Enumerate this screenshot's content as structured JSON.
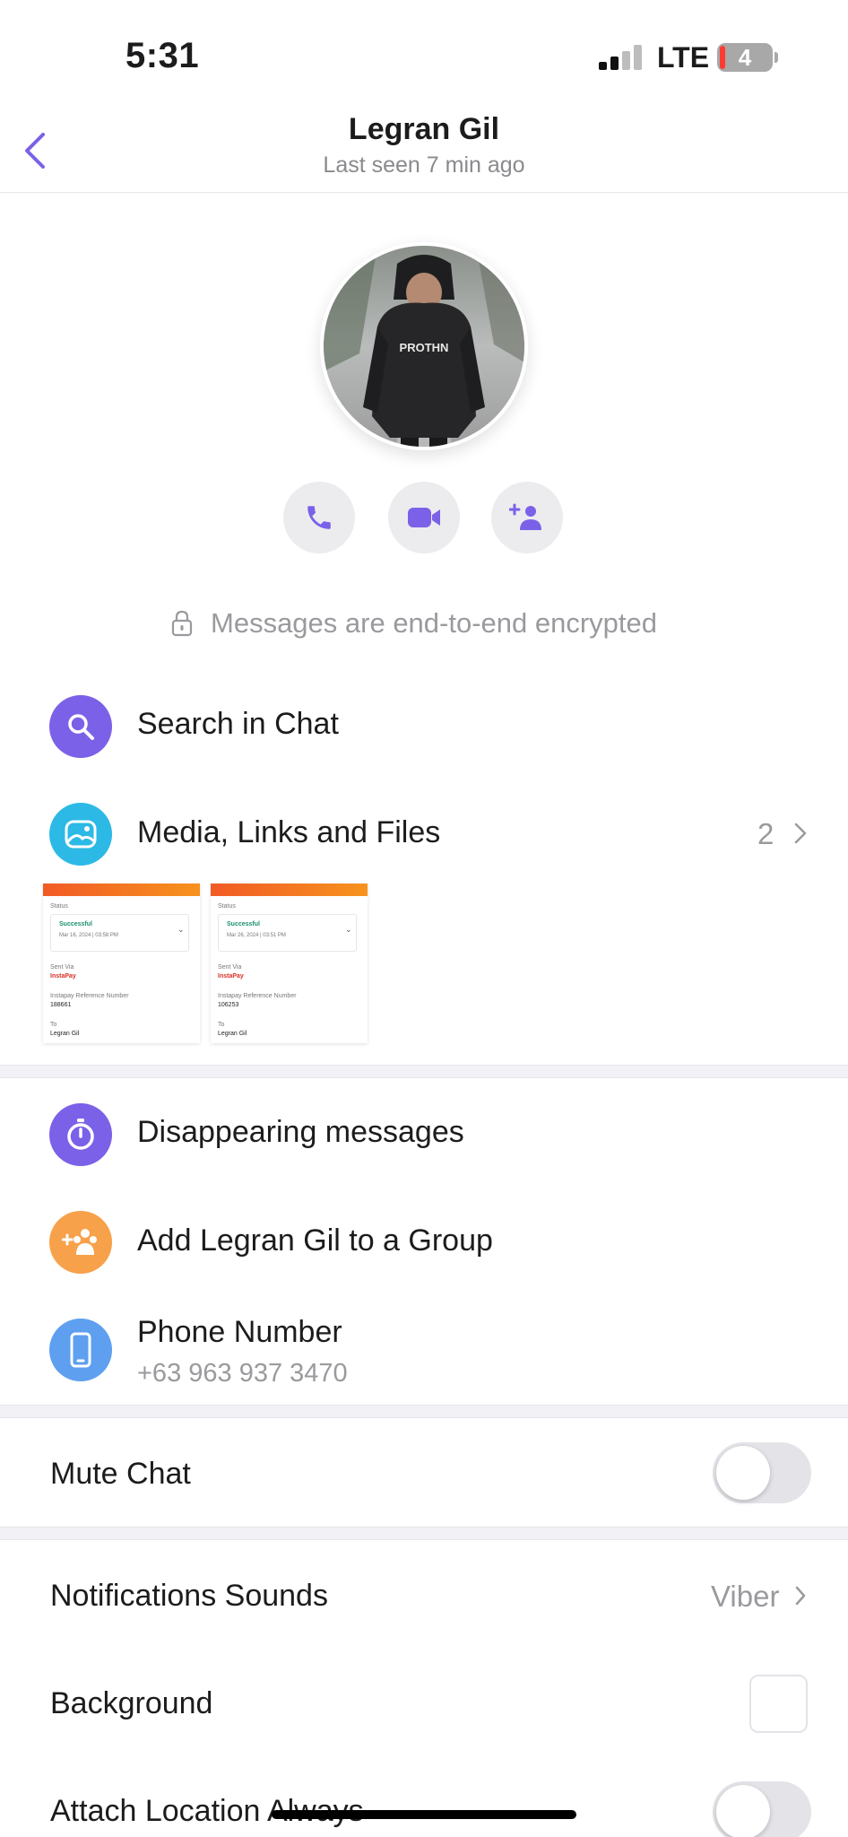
{
  "status_bar": {
    "time": "5:31",
    "network": "LTE",
    "battery_level": "4",
    "signal_bars_active": 2,
    "signal_bars_total": 4
  },
  "header": {
    "back_icon": "chevron-left-icon",
    "contact_name": "Legran Gil",
    "last_seen": "Last seen 7 min ago"
  },
  "avatar": {
    "shirt_text": "PROTHN"
  },
  "actions": [
    {
      "icon": "phone-icon"
    },
    {
      "icon": "video-camera-icon"
    },
    {
      "icon": "add-contact-icon"
    }
  ],
  "encryption": {
    "text": "Messages are end-to-end encrypted"
  },
  "menu": {
    "search": {
      "label": "Search in Chat"
    },
    "media": {
      "label": "Media, Links and Files",
      "count": "2"
    },
    "disappearing": {
      "label": "Disappearing messages"
    },
    "add_group": {
      "label": "Add Legran Gil to a Group"
    },
    "phone": {
      "label": "Phone Number",
      "value": "+63 963 937 3470"
    }
  },
  "media_thumbs": [
    {
      "status_label": "Status",
      "status_value": "Successful",
      "date": "Mar 16, 2024 | 03:58 PM",
      "sent_via_label": "Sent Via",
      "sent_via": "InstaPay",
      "ref_label": "Instapay Reference Number",
      "ref": "188661",
      "to_label": "To",
      "to": "Legran Gil"
    },
    {
      "status_label": "Status",
      "status_value": "Successful",
      "date": "Mar 26, 2024 | 03:51 PM",
      "sent_via_label": "Sent Via",
      "sent_via": "InstaPay",
      "ref_label": "Instapay Reference Number",
      "ref": "106253",
      "to_label": "To",
      "to": "Legran Gil"
    }
  ],
  "settings": {
    "mute": {
      "label": "Mute Chat",
      "on": false
    },
    "notifications": {
      "label": "Notifications Sounds",
      "value": "Viber"
    },
    "background": {
      "label": "Background"
    },
    "location": {
      "label": "Attach Location Always",
      "on": false
    }
  },
  "colors": {
    "accent": "#7b61e8",
    "media_icon": "#2cb9e6",
    "group_icon": "#f7a14a",
    "phone_icon": "#5e9ff0"
  }
}
